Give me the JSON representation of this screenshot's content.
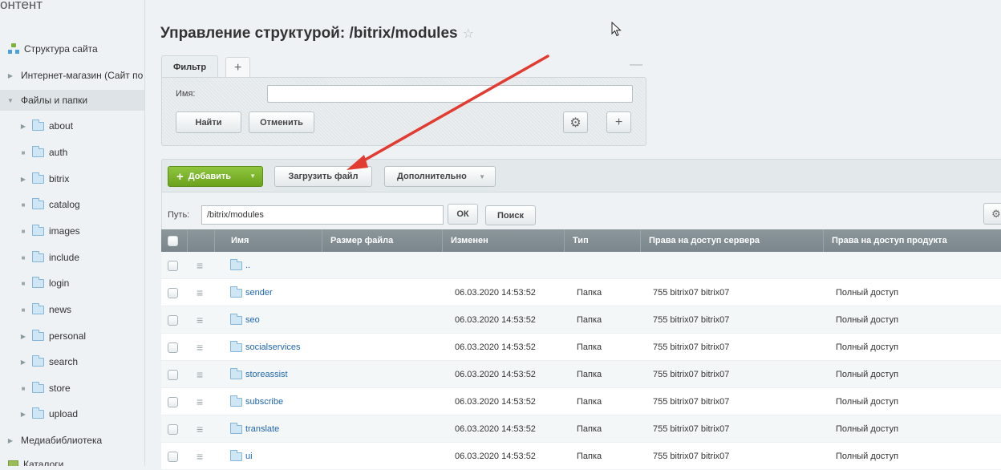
{
  "sidebar": {
    "section_title": "онтент",
    "items": [
      {
        "label": "Структура сайта"
      },
      {
        "label": "Интернет-магазин (Сайт по"
      },
      {
        "label": "Файлы и папки"
      },
      {
        "label": "about"
      },
      {
        "label": "auth"
      },
      {
        "label": "bitrix"
      },
      {
        "label": "catalog"
      },
      {
        "label": "images"
      },
      {
        "label": "include"
      },
      {
        "label": "login"
      },
      {
        "label": "news"
      },
      {
        "label": "personal"
      },
      {
        "label": "search"
      },
      {
        "label": "store"
      },
      {
        "label": "upload"
      },
      {
        "label": "Медиабиблиотека"
      },
      {
        "label": "Каталоги"
      }
    ]
  },
  "page": {
    "title": "Управление структурой: /bitrix/modules",
    "star": "☆"
  },
  "filter": {
    "tab_label": "Фильтр",
    "add_tab": "+",
    "minimize": "—",
    "name_label": "Имя:",
    "name_value": "",
    "find_button": "Найти",
    "cancel_button": "Отменить",
    "settings_icon": "gear-icon",
    "add_button": "+"
  },
  "toolbar": {
    "add_button": "Добавить",
    "upload_button": "Загрузить файл",
    "more_button": "Дополнительно"
  },
  "path": {
    "label": "Путь:",
    "value": "/bitrix/modules",
    "ok_button": "ОК",
    "search_button": "Поиск"
  },
  "table": {
    "headers": {
      "name": "Имя",
      "size": "Размер файла",
      "modified": "Изменен",
      "type": "Тип",
      "server_rights": "Права на доступ сервера",
      "product_rights": "Права на доступ продукта"
    },
    "up_row": "..",
    "rows": [
      {
        "name": "sender",
        "modified": "06.03.2020 14:53:52",
        "type": "Папка",
        "server_rights": "755 bitrix07 bitrix07",
        "product_rights": "Полный доступ"
      },
      {
        "name": "seo",
        "modified": "06.03.2020 14:53:52",
        "type": "Папка",
        "server_rights": "755 bitrix07 bitrix07",
        "product_rights": "Полный доступ"
      },
      {
        "name": "socialservices",
        "modified": "06.03.2020 14:53:52",
        "type": "Папка",
        "server_rights": "755 bitrix07 bitrix07",
        "product_rights": "Полный доступ"
      },
      {
        "name": "storeassist",
        "modified": "06.03.2020 14:53:52",
        "type": "Папка",
        "server_rights": "755 bitrix07 bitrix07",
        "product_rights": "Полный доступ"
      },
      {
        "name": "subscribe",
        "modified": "06.03.2020 14:53:52",
        "type": "Папка",
        "server_rights": "755 bitrix07 bitrix07",
        "product_rights": "Полный доступ"
      },
      {
        "name": "translate",
        "modified": "06.03.2020 14:53:52",
        "type": "Папка",
        "server_rights": "755 bitrix07 bitrix07",
        "product_rights": "Полный доступ"
      },
      {
        "name": "ui",
        "modified": "06.03.2020 14:53:52",
        "type": "Папка",
        "server_rights": "755 bitrix07 bitrix07",
        "product_rights": "Полный доступ"
      }
    ]
  },
  "colors": {
    "accent_green": "#7ab32e",
    "link_blue": "#2067b0",
    "header_gray": "#83909a",
    "annotation_red": "#e23b32"
  }
}
